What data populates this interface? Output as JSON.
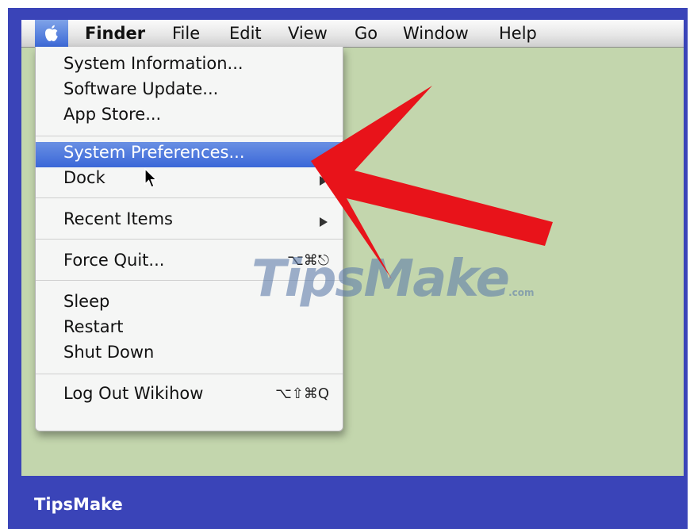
{
  "menubar": {
    "apple_icon": "apple-icon",
    "items": [
      "Finder",
      "File",
      "Edit",
      "View",
      "Go",
      "Window",
      "Help"
    ]
  },
  "apple_menu": {
    "system_information": "System Information...",
    "software_update": "Software Update...",
    "app_store": "App Store...",
    "system_preferences": "System Preferences...",
    "dock": "Dock",
    "recent_items": "Recent Items",
    "force_quit": "Force Quit...",
    "force_quit_shortcut": "⌥⌘⎋",
    "sleep": "Sleep",
    "restart": "Restart",
    "shut_down": "Shut Down",
    "log_out": "Log Out Wikihow",
    "log_out_shortcut": "⌥⇧⌘Q",
    "selected": "System Preferences..."
  },
  "watermark": {
    "text": "TipsMake",
    "suffix": ".com"
  },
  "footer": {
    "brand": "TipsMake"
  },
  "colors": {
    "frame": "#3a44b8",
    "desktop": "#c3d6ad",
    "highlight": "#3a67d8",
    "arrow": "#e8131a"
  }
}
